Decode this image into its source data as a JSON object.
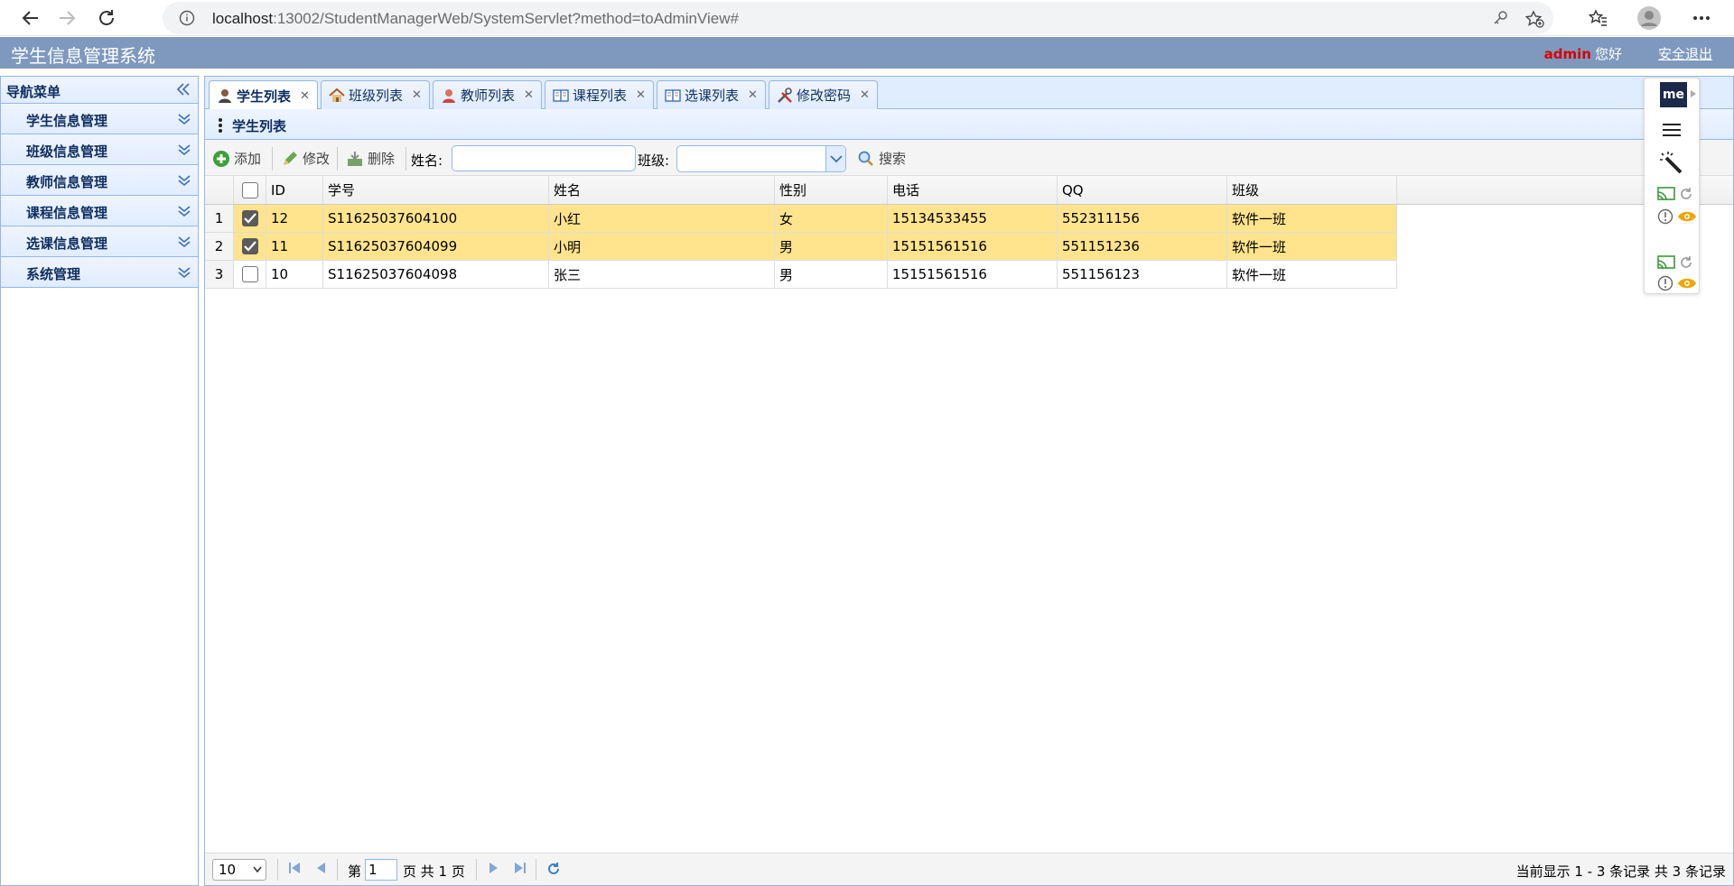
{
  "browser": {
    "url_host": "localhost",
    "url_rest": ":13002/StudentManagerWeb/SystemServlet?method=toAdminView#"
  },
  "header": {
    "title": "学生信息管理系统",
    "user": "admin",
    "greeting": "您好",
    "logout": "安全退出"
  },
  "sidebar": {
    "title": "导航菜单",
    "items": [
      {
        "label": "学生信息管理"
      },
      {
        "label": "班级信息管理"
      },
      {
        "label": "教师信息管理"
      },
      {
        "label": "课程信息管理"
      },
      {
        "label": "选课信息管理"
      },
      {
        "label": "系统管理"
      }
    ]
  },
  "tabs": [
    {
      "label": "学生列表",
      "icon": "student-icon",
      "active": true
    },
    {
      "label": "班级列表",
      "icon": "house-icon",
      "active": false
    },
    {
      "label": "教师列表",
      "icon": "teacher-icon",
      "active": false
    },
    {
      "label": "课程列表",
      "icon": "book-icon",
      "active": false
    },
    {
      "label": "选课列表",
      "icon": "book-icon",
      "active": false
    },
    {
      "label": "修改密码",
      "icon": "tools-icon",
      "active": false
    }
  ],
  "panel": {
    "title": "学生列表"
  },
  "toolbar": {
    "add": "添加",
    "edit": "修改",
    "delete": "删除",
    "name_label": "姓名:",
    "name_value": "",
    "class_label": "班级:",
    "class_value": "",
    "search": "搜索"
  },
  "grid": {
    "columns": [
      "ID",
      "学号",
      "姓名",
      "性别",
      "电话",
      "QQ",
      "班级"
    ],
    "rows": [
      {
        "num": "1",
        "checked": true,
        "id": "12",
        "sno": "S11625037604100",
        "name": "小红",
        "sex": "女",
        "phone": "15134533455",
        "qq": "552311156",
        "clazz": "软件一班"
      },
      {
        "num": "2",
        "checked": true,
        "id": "11",
        "sno": "S11625037604099",
        "name": "小明",
        "sex": "男",
        "phone": "15151561516",
        "qq": "551151236",
        "clazz": "软件一班"
      },
      {
        "num": "3",
        "checked": false,
        "id": "10",
        "sno": "S11625037604098",
        "name": "张三",
        "sex": "男",
        "phone": "15151561516",
        "qq": "551156123",
        "clazz": "软件一班"
      }
    ]
  },
  "pager": {
    "page_size": "10",
    "page_prefix": "第",
    "page_value": "1",
    "page_suffix": "页 共 1 页",
    "info": "当前显示 1 - 3 条记录 共 3 条记录"
  },
  "extension": {
    "logo": "me"
  },
  "colors": {
    "header_bg": "#7f99be",
    "selected_row": "#ffe48d",
    "accent_red": "#d60000"
  }
}
